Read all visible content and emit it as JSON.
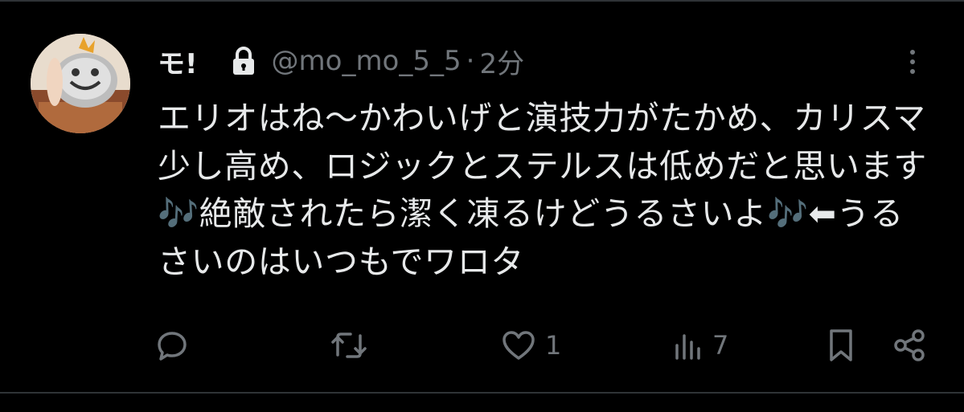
{
  "tweet": {
    "author_name": "モ!",
    "handle": "@mo_mo_5_5",
    "separator": "·",
    "time": "2分",
    "text": "エリオはね～かわいげと演技力がたかめ、カリスマ少し高め、ロジックとステルスは低めだと思います🎶絶敵されたら潔く凍るけどうるさいよ🎶⬅うるさいのはいつもでワロタ"
  },
  "actions": {
    "likes": "1",
    "views": "7"
  },
  "icons": {
    "lock": "lock-icon",
    "more": "more-icon",
    "reply": "reply-icon",
    "retweet": "retweet-icon",
    "like": "heart-icon",
    "views": "views-icon",
    "bookmark": "bookmark-icon",
    "share": "share-icon"
  },
  "colors": {
    "background": "#000000",
    "text": "#e7e9ea",
    "muted": "#71767b",
    "divider": "#2f3336"
  }
}
